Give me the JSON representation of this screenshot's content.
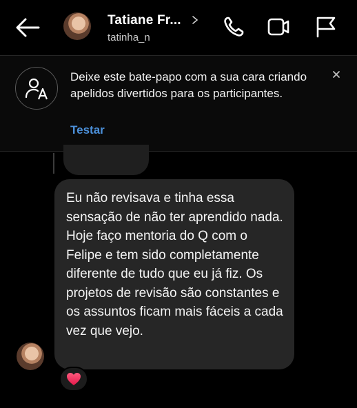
{
  "header": {
    "contact_name": "Tatiane Fr...",
    "username": "tatinha_n"
  },
  "banner": {
    "message": "Deixe este bate-papo com a sua cara criando apelidos divertidos para os participantes.",
    "action_label": "Testar"
  },
  "chat": {
    "message": "Eu não revisava e tinha essa sensação de não ter aprendido nada. Hoje faço mentoria do Q com o Felipe e tem sido completamente diferente de tudo que eu já fiz. Os projetos de revisão são constantes e os assuntos ficam mais fáceis a cada vez que vejo.",
    "reaction": "heart"
  },
  "colors": {
    "background": "#000000",
    "bubble": "#262626",
    "link": "#4b8fd8",
    "reaction_heart": "#ff3b5c"
  },
  "icons": [
    "back-arrow-icon",
    "chevron-right-icon",
    "phone-icon",
    "video-camera-icon",
    "flag-icon",
    "nickname-icon",
    "close-icon",
    "heart-icon"
  ]
}
